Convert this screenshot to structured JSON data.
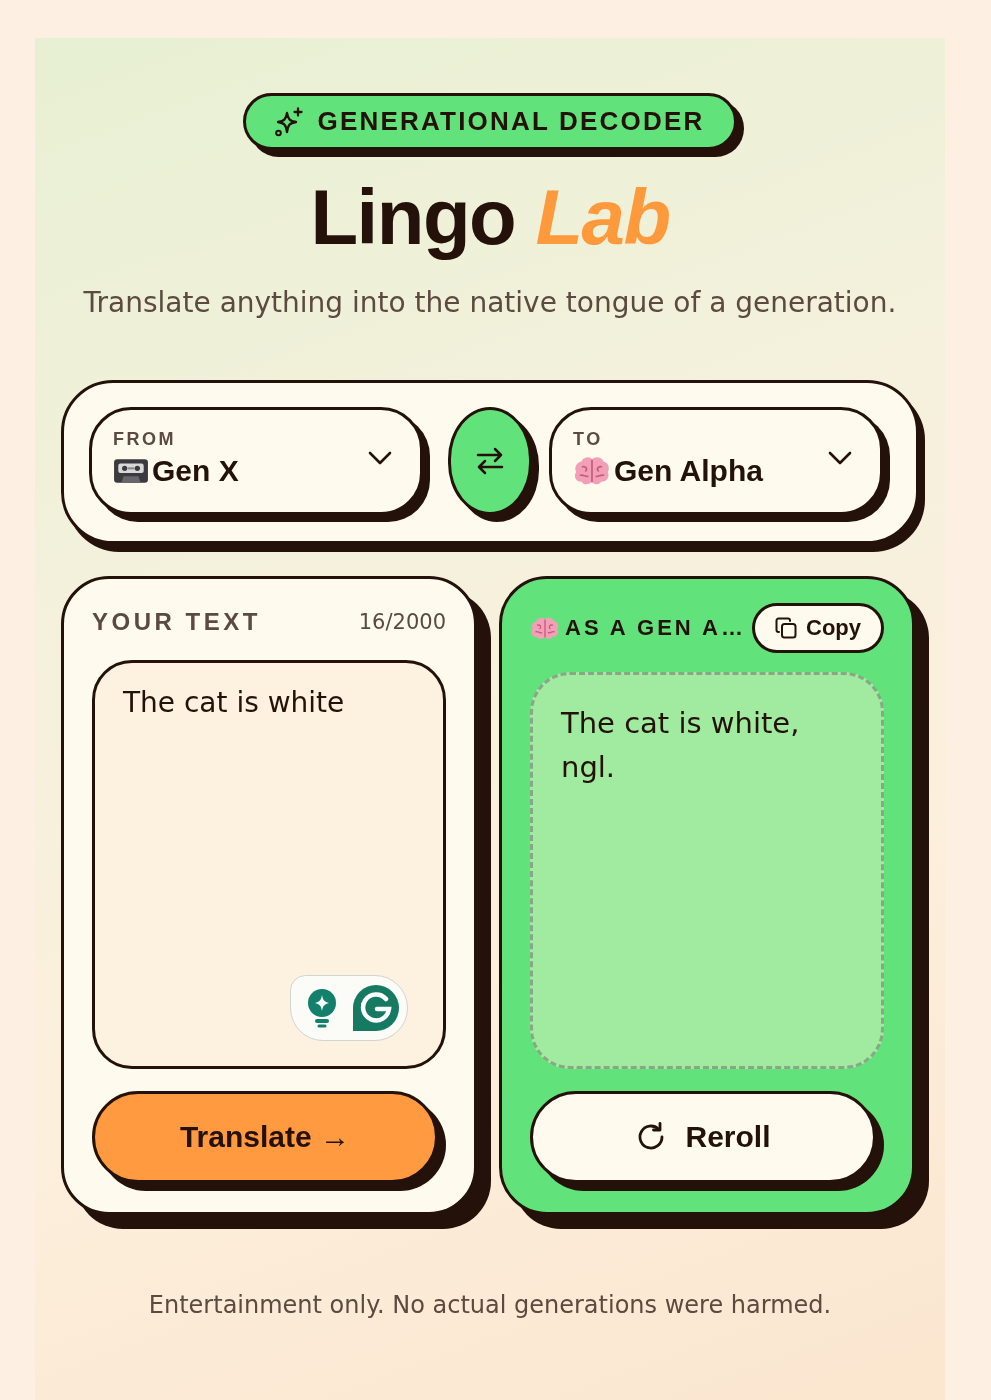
{
  "badge": {
    "label": "GENERATIONAL DECODER"
  },
  "title": "Lingo *Lab*",
  "subtitle": "Translate anything into the native tongue of a generation.",
  "languages": {
    "from": {
      "label": "FROM",
      "value": "Gen X"
    },
    "to": {
      "label": "TO",
      "value": "Gen Alpha"
    }
  },
  "input": {
    "heading": "YOUR TEXT",
    "count": "16/2000",
    "value": "The cat is white",
    "button": "Translate →"
  },
  "output": {
    "heading": "AS A GEN A…",
    "copy_button": "Copy",
    "text": "The cat is white, ngl.",
    "button": "Reroll"
  },
  "footer": "Entertainment only. No actual generations were harmed."
}
